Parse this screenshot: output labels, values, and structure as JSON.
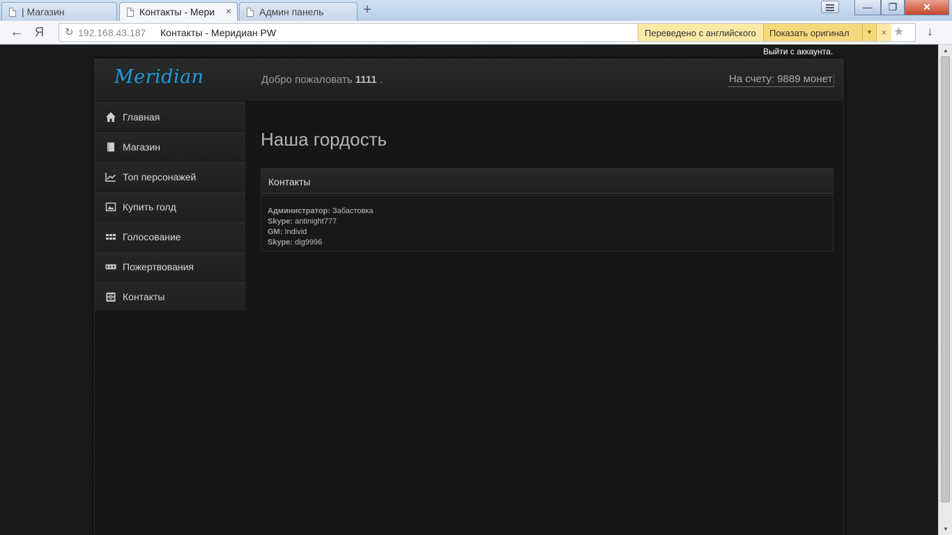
{
  "browser": {
    "tabs": [
      {
        "label": "| Магазин"
      },
      {
        "label": "Контакты - Мери"
      },
      {
        "label": "Админ панель"
      }
    ],
    "new_tab": "+",
    "back": "←",
    "yandex": "Я",
    "url_host": "192.168.43.187",
    "url_title": "Контакты - Меридиан PW",
    "translate_note": "Переведено с английского",
    "translate_show": "Показать оригинал",
    "translate_close": "×",
    "star": "★",
    "download": "↓"
  },
  "window": {
    "minimize": "—",
    "maximize": "❐",
    "close": "✕"
  },
  "page": {
    "logout": "Выйти с аккаунта.",
    "logo": "Meridian",
    "welcome_prefix": "Добро пожаловать ",
    "welcome_user": "1111",
    "welcome_suffix": " .",
    "balance": "На счету: 9889 монет",
    "nav": [
      {
        "label": "Главная",
        "icon": "home-icon"
      },
      {
        "label": "Магазин",
        "icon": "book-icon"
      },
      {
        "label": "Топ персонажей",
        "icon": "chart-icon"
      },
      {
        "label": "Купить голд",
        "icon": "picture-icon"
      },
      {
        "label": "Голосование",
        "icon": "grid-icon"
      },
      {
        "label": "Пожертвования",
        "icon": "forward-icon"
      },
      {
        "label": "Контакты",
        "icon": "cabinet-icon"
      }
    ],
    "heading": "Наша гордость",
    "panel_title": "Контакты",
    "contacts": [
      {
        "key": "Администратор:",
        "value": "Забастовка"
      },
      {
        "key": "Skype:",
        "value": "antinight777"
      },
      {
        "key": "GM:",
        "value": "Individ"
      },
      {
        "key": "Skype:",
        "value": "dig9996"
      }
    ]
  }
}
